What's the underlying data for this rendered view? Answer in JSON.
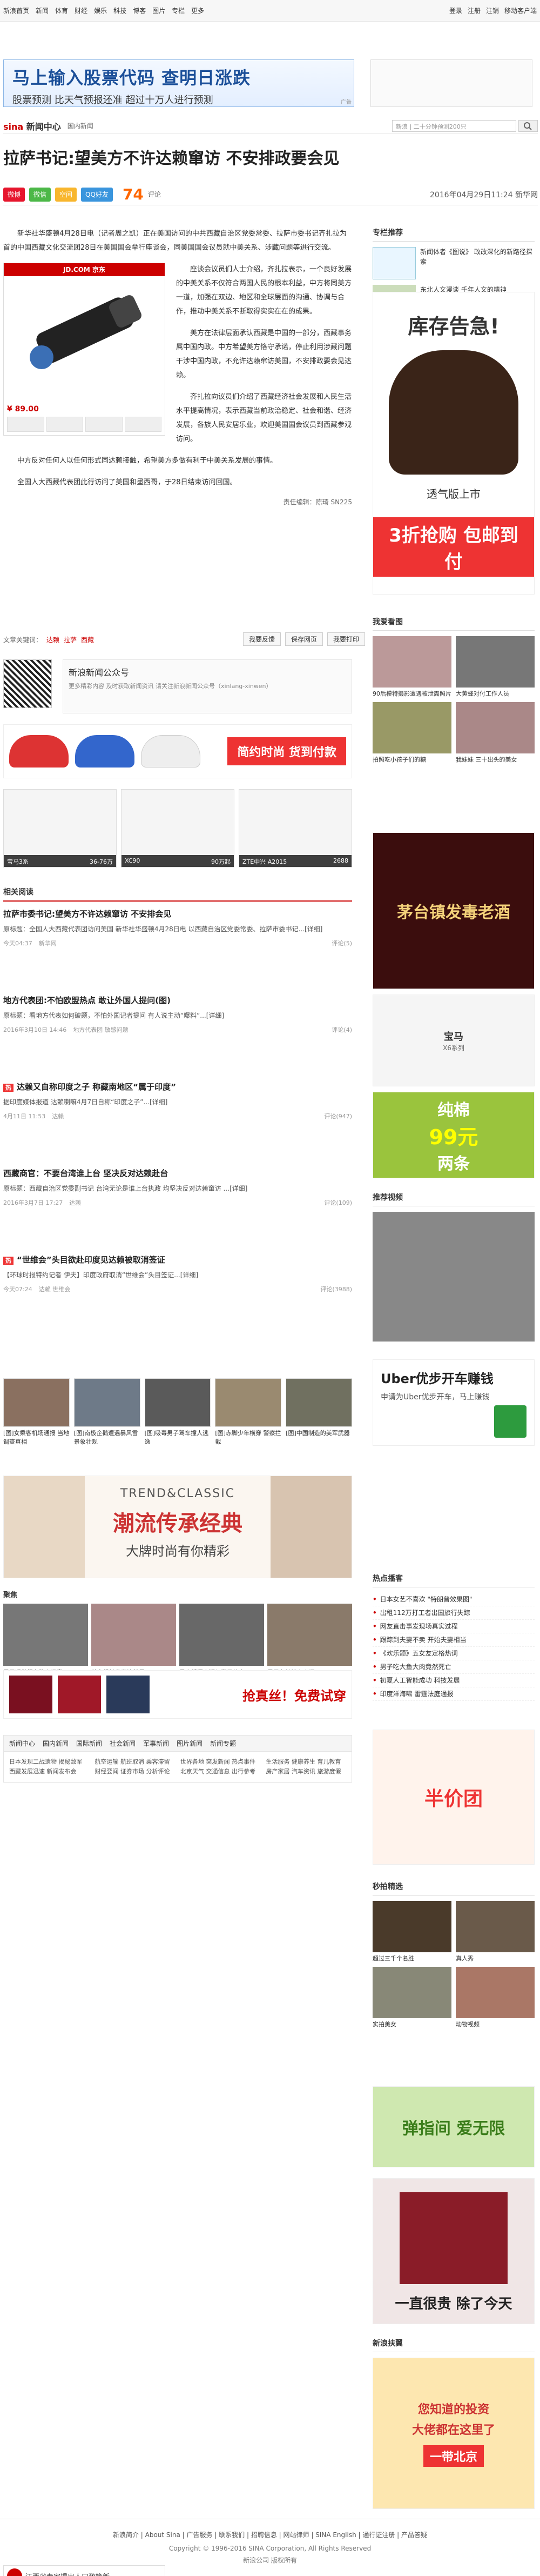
{
  "topnav": {
    "items": [
      "新浪首页",
      "新闻",
      "体育",
      "财经",
      "娱乐",
      "科技",
      "博客",
      "图片",
      "专栏",
      "更多"
    ],
    "right": [
      "登录",
      "注册",
      "注销",
      "移动客户端"
    ]
  },
  "banner": {
    "line1": "马上输入股票代码  查明日涨跌",
    "line2": "股票预测 比天气预报还准 超过十万人进行预测",
    "tag": "广告"
  },
  "header": {
    "logo_main": "sina",
    "logo_sub": "新闻中心",
    "crumb": "国内新闻",
    "search_placeholder": "新浪 | 二十分钟预测200只",
    "search_button": "搜索"
  },
  "article": {
    "title": "拉萨书记:望美方不许达赖窜访 不安排政要会见",
    "share": [
      "微博",
      "微信",
      "空间",
      "QQ好友"
    ],
    "comment_count": "74",
    "comment_label": "评论",
    "date": "2016年04月29日11:24",
    "source": "新华网",
    "paragraphs": [
      "新华社华盛顿4月28日电（记者周之凯）正在美国访问的中共西藏自治区党委常委、拉萨市委书记齐扎拉为首的中国西藏文化交流团28日在美国国会举行座谈会，同美国国会议员就中美关系、涉藏问题等进行交流。",
      "座谈会议员们人士介绍，齐扎拉表示，一个良好发展的中美关系不仅符合两国人民的根本利益，中方将同美方一道，加强在双边、地区和全球层面的沟通、协调与合作，推动中美关系不断取得实实在在的成果。",
      "美方在法律层面承认西藏是中国的一部分，西藏事务属中国内政。中方希望美方恪守承诺，停止利用涉藏问题干涉中国内政，不允许达赖窜访美国，不安排政要会见达赖。",
      "齐扎拉向议员们介绍了西藏经济社会发展和人民生活水平提高情况，表示西藏当前政治稳定、社会和谐、经济发展，各族人民安居乐业，欢迎美国国会议员到西藏参观访问。",
      "中方反对任何人以任何形式同达赖接触，希望美方多做有利于中美关系发展的事情。",
      "全国人大西藏代表团此行访问了美国和墨西哥，于28日结束访问回国。"
    ],
    "jd_head": "JD.COM 京东",
    "jd_price": "¥ 89.00",
    "editor": "责任编辑：陈琦 SN225"
  },
  "keywords": {
    "label": "文章关键词：",
    "items": [
      "达赖",
      "拉萨",
      "西藏"
    ]
  },
  "ops": [
    "我要反馈",
    "保存网页",
    "我要打印"
  ],
  "wechat": {
    "title": "新浪新闻公众号",
    "sub": "更多精彩内容 及时获取新闻资讯 请关注新浪新闻公众号（xinlang-xinwen）"
  },
  "shoead": {
    "tag": "简约时尚 货到付款"
  },
  "cars": [
    {
      "name": "宝马3系",
      "price": "36-76万"
    },
    {
      "name": "XC90",
      "price": "90万起"
    },
    {
      "name": "ZTE中兴 A2015",
      "price": "2688"
    }
  ],
  "related": {
    "heading": "相关阅读",
    "items": [
      {
        "title": "拉萨市委书记:望美方不许达赖窜访 不安排会见",
        "desc": "原标题：全国人大西藏代表团访问美国 新华社华盛顿4月28日电 以西藏自治区党委常委、拉萨市委书记...[详细]",
        "time": "今天04:37",
        "src": "新华网",
        "comment": "评论(5)"
      },
      {
        "title": "地方代表团:不怕欧盟热点 敢让外国人提问(图)",
        "desc": "原标题：看地方代表如何破题，不怕外国记者提问 有人说主动“曝料”...[详细]",
        "time": "2016年3月10日 14:46",
        "src": "地方代表团 敏感问题",
        "comment": "评论(4)"
      },
      {
        "title": "达赖又自称印度之子 称藏南地区“属于印度”",
        "desc": "据印度媒体报道 达赖喇嘛4月7日自称“印度之子”...[详细]",
        "time": "4月11日 11:53",
        "src": "达赖",
        "comment": "评论(947)"
      },
      {
        "title": "西藏商官：不要台湾谁上台 坚决反对达赖赴台",
        "desc": "原标题：西藏自治区党委副书记 台湾无论是谁上台执政 均坚决反对达赖窜访 ...[详细]",
        "time": "2016年3月7日 17:27",
        "src": "达赖",
        "comment": "评论(109)"
      },
      {
        "title": "“世维会”头目欲赴印度见达赖被取消签证",
        "desc": "【环球时报特约记者 伊夫】印度政府取消“世维会”头目签证...[详细]",
        "time": "今天07:24",
        "src": "达赖 世维会",
        "comment": "评论(3988)"
      }
    ]
  },
  "imgrow": [
    "[图]女乘客机场通报 当地调查真相",
    "[图]南极企鹅遭遇暴风雪 景象壮观",
    "[图]吸毒男子驾车撞人逃逸",
    "[图]赤脚少年横穿 警察拦截",
    "[图]中国制造的美军武器"
  ],
  "trendad": {
    "t1": "TREND&CLASSIC",
    "t2": "潮流传承经典",
    "t3": "大牌时尚有你精彩"
  },
  "pics": {
    "heading": "聚焦",
    "items": [
      "男子遭举报在路上吸毒",
      "美女模特身穿比基尼",
      "吴立斌深夜疑与妻子约会",
      "男子在地铁上大闹"
    ]
  },
  "shirtad": {
    "tag": "抢真丝！免费试穿"
  },
  "footlinks": {
    "tabs": [
      "新闻中心",
      "国内新闻",
      "国际新闻",
      "社会新闻",
      "军事新闻",
      "图片新闻",
      "新闻专题"
    ],
    "cols": [
      "日本发现二战遗物 揭秘敌军\n西藏发展迅速 新闻发布会",
      "航空运输 航班取消 乘客滞留\n财经要闻 证券市场 分析评论",
      "世界各地 突发新闻 热点事件\n北京天气 交通信息 出行参考",
      "生活服务 健康养生 育儿教育\n房产家居 汽车资讯 旅游度假"
    ]
  },
  "right": {
    "heading_rec": "专栏推荐",
    "rec": [
      {
        "text": "新闻体者《图说》 政改深化的新路径探索"
      },
      {
        "text": "东北人文漫谈 千年人文的精神"
      }
    ],
    "shoe_ad": {
      "t1": "库存告急!",
      "t2": "透气版上市",
      "t3": "3折抢购 包邮到付"
    },
    "heading_watch": "我爱看图",
    "watch": [
      "90后模特摄影遭遇被泄露照片",
      "大黄蜂对付工作人员",
      "拍照吃小孩子们的糖",
      "我妹妹 三十出头的美女"
    ],
    "liquor_ad": "茅台镇发毒老酒",
    "car_ad": {
      "name": "宝马",
      "sub": "X6系列"
    },
    "fashion_ad": {
      "t1": "纯棉",
      "t2": "99元",
      "t3": "两条"
    },
    "heading_video": "推荐视频",
    "uber_ad": {
      "t1": "Uber优步开车赚钱",
      "t2": "申请为Uber优步开车，马上赚钱"
    },
    "heading_hot": "热点播客",
    "hot": [
      "日本女艺不喜欢 \"特朗普效果图\"",
      "出租112万打工者出国旅行失踪",
      "网友直击事发现场真实过程",
      "跟踪到夫妻不卖 开始夫妻相当",
      "《欢乐颂》五女友定格热词",
      "男子吃大鱼大肉竟然死亡",
      "初夏人工智能成功 科技发展",
      "印度洋海啸 雷霆法庭通报"
    ],
    "tb_ad": "半价团",
    "heading_wonder": "秒拍精选",
    "wonder": [
      "超过三千个名胜",
      "真人秀",
      "实拍美女",
      "动物视频"
    ],
    "game_ad": "弹指间 爱无限",
    "shirt_ad": "一直很贵 除了今天",
    "heading_tech": "新浪扶翼",
    "invest_ad": {
      "t1": "您知道的投资",
      "t2": "大佬都在这里了",
      "t3": "一带北京"
    }
  },
  "footer": {
    "links": "新浪简介 | About Sina | 广告服务 | 联系我们 | 招聘信息 | 网站律师 | SINA English | 通行证注册 | 产品答疑",
    "copyright": "Copyright © 1996-2016 SINA Corporation, All Rights Reserved",
    "icp": "新浪公司 版权所有"
  },
  "floatbar": {
    "text": "江西省专家提出人口政策新"
  }
}
